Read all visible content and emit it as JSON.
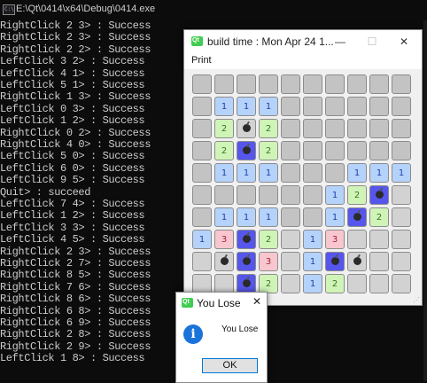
{
  "console": {
    "path": "E:\\Qt\\0414\\x64\\Debug\\0414.exe",
    "icon_text": "C:\\",
    "lines": [
      "RightClick 2 3> : Success",
      "RightClick 2 3> : Success",
      "RightClick 2 2> : Success",
      "LeftClick 3 2> : Success",
      "LeftClick 4 1> : Success",
      "LeftClick 5 1> : Success",
      "RightClick 1 3> : Success",
      "LeftClick 0 3> : Success",
      "LeftClick 1 2> : Success",
      "RightClick 0 2> : Success",
      "RightClick 4 0> : Success",
      "LeftClick 5 0> : Success",
      "LeftClick 6 0> : Success",
      "LeftClick 9 5> : Success",
      "Quit> : succeed",
      "LeftClick 7 4> : Success",
      "LeftClick 1 2> : Success",
      "LeftClick 3 3> : Success",
      "LeftClick 4 5> : Success",
      "RightClick 2 3> : Success",
      "RightClick 2 7> : Success",
      "RightClick 8 5> : Success",
      "RightClick 7 6> : Success",
      "RightClick 8 6> : Success",
      "RightClick 6 8> : Success",
      "RightClick 6 9> : Success",
      "RightClick 2 8> : Success",
      "RightClick 2 9> : Success",
      "LeftClick 1 8> : Success"
    ]
  },
  "game_window": {
    "icon_text": "Qt",
    "title": "build time : Mon Apr 24 1...",
    "minimize": "—",
    "maximize": "☐",
    "close": "✕",
    "menu_print": "Print",
    "board": [
      [
        "c",
        "c",
        "c",
        "c",
        "c",
        "c",
        "c",
        "c",
        "c",
        "c"
      ],
      [
        "c",
        "b1",
        "b1",
        "b1",
        "c",
        "c",
        "c",
        "c",
        "c",
        "c"
      ],
      [
        "c",
        "g2",
        "bomb",
        "g2",
        "c",
        "c",
        "c",
        "c",
        "c",
        "c"
      ],
      [
        "c",
        "g2",
        "mine",
        "g2",
        "c",
        "c",
        "c",
        "c",
        "c",
        "c"
      ],
      [
        "c",
        "b1",
        "b1",
        "b1",
        "c",
        "c",
        "c",
        "b1",
        "b1",
        "b1"
      ],
      [
        "c",
        "c",
        "c",
        "c",
        "c",
        "c",
        "b1",
        "g2",
        "mine",
        "o"
      ],
      [
        "c",
        "b1",
        "b1",
        "b1",
        "c",
        "c",
        "b1",
        "mine",
        "g2",
        "o"
      ],
      [
        "b1",
        "p3",
        "mine",
        "g2",
        "o",
        "b1",
        "p3",
        "o",
        "o",
        "o"
      ],
      [
        "o",
        "bomb",
        "mine",
        "p3",
        "o",
        "b1",
        "mine",
        "bomb",
        "o",
        "o"
      ],
      [
        "o",
        "o",
        "mine",
        "g2",
        "o",
        "b1",
        "g2",
        "o",
        "o",
        "o"
      ]
    ]
  },
  "dialog": {
    "icon_text": "Qt",
    "title": "You Lose",
    "close": "✕",
    "info_glyph": "i",
    "message": "You Lose",
    "ok_label": "OK"
  }
}
